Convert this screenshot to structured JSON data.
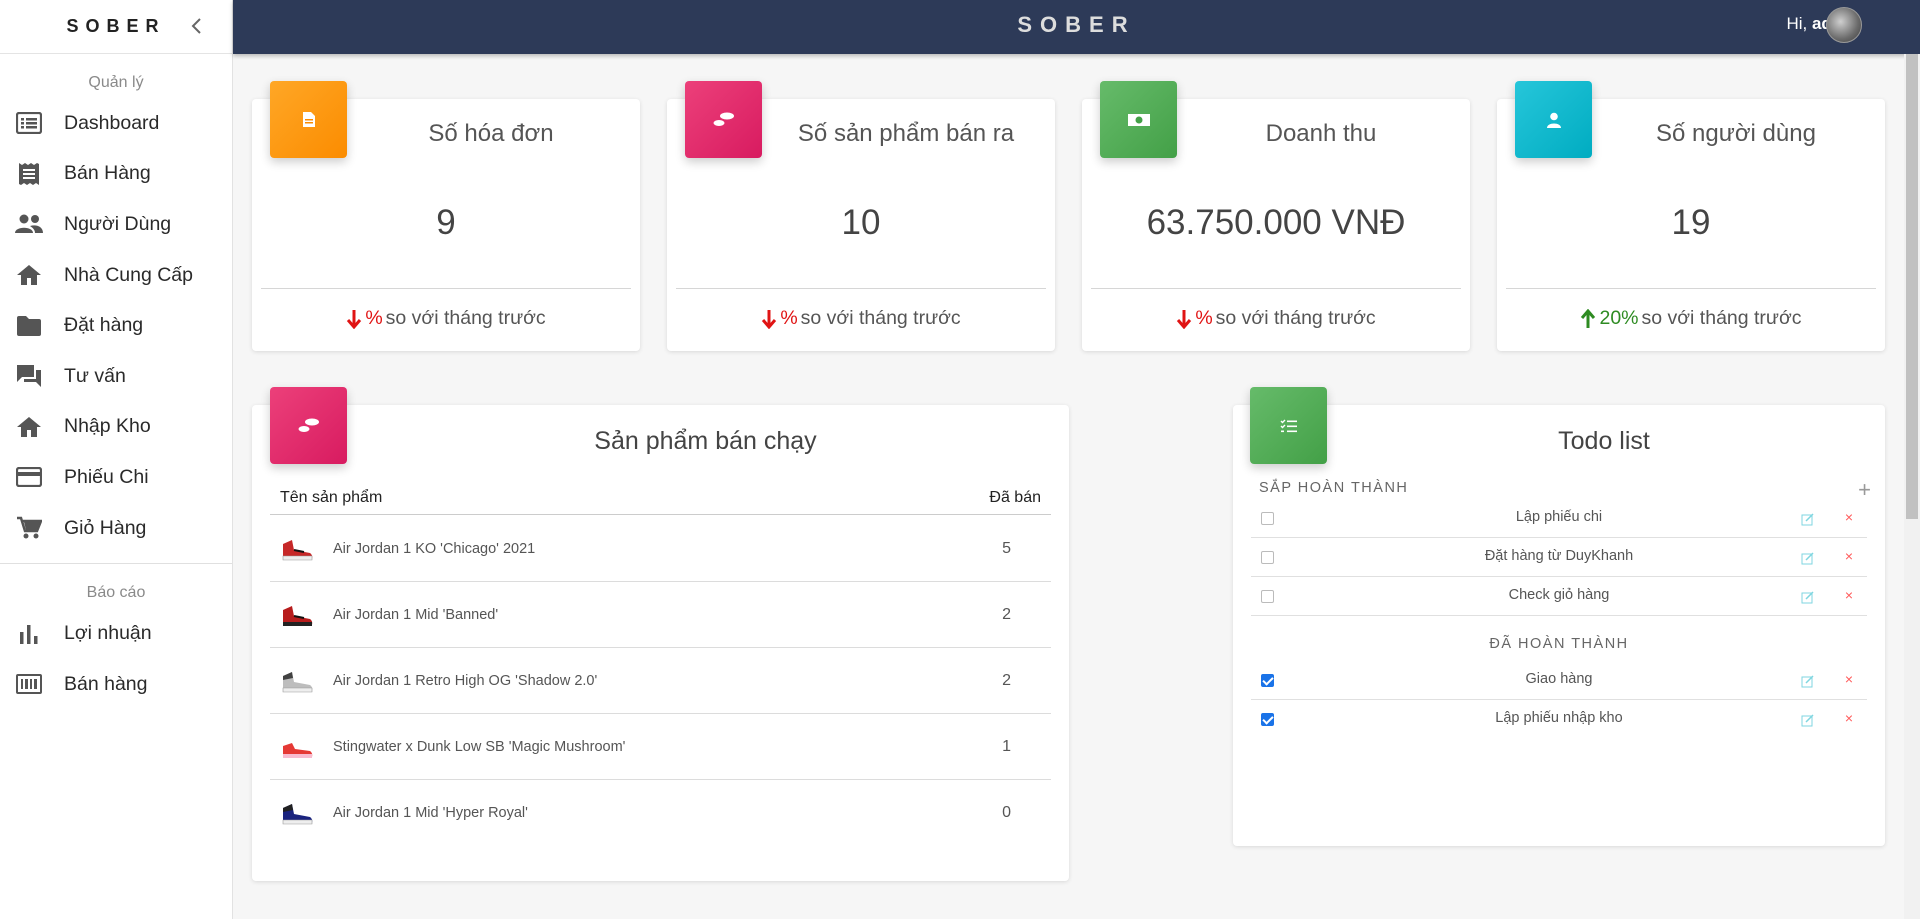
{
  "sidebar": {
    "logo": "SOBER",
    "section_manage": "Quản lý",
    "section_report": "Báo cáo",
    "items": [
      {
        "label": "Dashboard",
        "icon": "list-icon"
      },
      {
        "label": "Bán Hàng",
        "icon": "receipt-icon"
      },
      {
        "label": "Người Dùng",
        "icon": "people-icon"
      },
      {
        "label": "Nhà Cung Cấp",
        "icon": "home-icon"
      },
      {
        "label": "Đặt hàng",
        "icon": "folder-icon"
      },
      {
        "label": "Tư vấn",
        "icon": "chat-icon"
      },
      {
        "label": "Nhập Kho",
        "icon": "home-icon"
      },
      {
        "label": "Phiếu Chi",
        "icon": "credit-card-icon"
      },
      {
        "label": "Giỏ Hàng",
        "icon": "cart-icon"
      }
    ],
    "report_items": [
      {
        "label": "Lợi nhuận",
        "icon": "bar-chart-icon"
      },
      {
        "label": "Bán hàng",
        "icon": "barcode-icon"
      }
    ]
  },
  "topbar": {
    "brand": "SOBER",
    "greeting": "Hi, ",
    "username": "admin"
  },
  "stats": [
    {
      "title": "Số hóa đơn",
      "value": "9",
      "pct": "%",
      "trend": "down",
      "compare": "so với tháng trước",
      "color": "#fb8c00"
    },
    {
      "title": "Số sản phẩm bán ra",
      "value": "10",
      "pct": "%",
      "trend": "down",
      "compare": "so với tháng trước",
      "color": "#d81b60"
    },
    {
      "title": "Doanh thu",
      "value": "63.750.000 VNĐ",
      "pct": "%",
      "trend": "down",
      "compare": "so với tháng trước",
      "color": "#43a047"
    },
    {
      "title": "Số người dùng",
      "value": "19",
      "pct": "20%",
      "trend": "up",
      "compare": "so với tháng trước",
      "color": "#00acc1"
    }
  ],
  "best_sellers": {
    "title": "Sản phẩm bán chạy",
    "col_name": "Tên sản phẩm",
    "col_sold": "Đã bán",
    "rows": [
      {
        "name": "Air Jordan 1 KO 'Chicago' 2021",
        "sold": "5",
        "shoe_color": "#c62828"
      },
      {
        "name": "Air Jordan 1 Mid 'Banned'",
        "sold": "2",
        "shoe_color": "#b71c1c"
      },
      {
        "name": "Air Jordan 1 Retro High OG 'Shadow 2.0'",
        "sold": "2",
        "shoe_color": "#616161"
      },
      {
        "name": "Stingwater x Dunk Low SB 'Magic Mushroom'",
        "sold": "1",
        "shoe_color": "#e53935"
      },
      {
        "name": "Air Jordan 1 Mid 'Hyper Royal'",
        "sold": "0",
        "shoe_color": "#1a237e"
      }
    ]
  },
  "todo": {
    "title": "Todo list",
    "pending_label": "SẮP HOÀN THÀNH",
    "done_label": "ĐÃ HOÀN THÀNH",
    "add_symbol": "+",
    "delete_symbol": "×",
    "pending": [
      "Lập phiếu chi",
      "Đặt hàng từ DuyKhanh",
      "Check giỏ hàng"
    ],
    "done": [
      "Giao hàng",
      "Lập phiếu nhập kho"
    ]
  }
}
